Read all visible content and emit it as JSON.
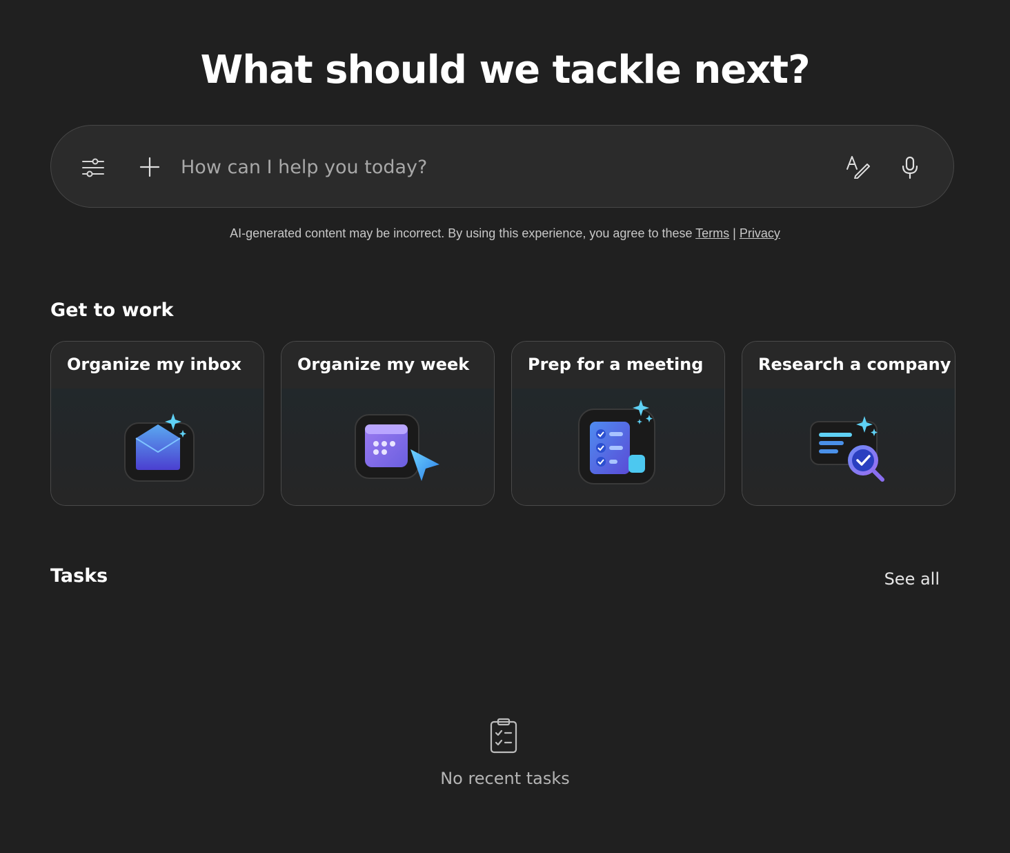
{
  "hero": {
    "title": "What should we tackle next?"
  },
  "prompt": {
    "placeholder": "How can I help you today?",
    "icons": [
      "sliders-icon",
      "plus-icon",
      "text-pen-icon",
      "microphone-icon"
    ]
  },
  "disclaimer": {
    "text": "AI-generated content may be incorrect. By using this experience, you agree to these ",
    "terms_label": "Terms",
    "separator": " | ",
    "privacy_label": "Privacy"
  },
  "get_to_work": {
    "heading": "Get to work",
    "cards": [
      {
        "label": "Organize my inbox",
        "icon": "mail-icon"
      },
      {
        "label": "Organize my week",
        "icon": "calendar-cursor-icon"
      },
      {
        "label": "Prep for a meeting",
        "icon": "checklist-icon"
      },
      {
        "label": "Research a company",
        "icon": "document-search-icon"
      }
    ]
  },
  "tasks": {
    "heading": "Tasks",
    "see_all_label": "See all",
    "empty_icon": "clipboard-check-icon",
    "empty_text": "No recent tasks"
  },
  "colors": {
    "background": "#202020",
    "prompt_bg": "#2b2b2b",
    "card_border": "#4a4a4a",
    "accent_blue": "#3a6ee8",
    "accent_purple": "#8a6ef0",
    "accent_cyan": "#5fd1f5"
  }
}
